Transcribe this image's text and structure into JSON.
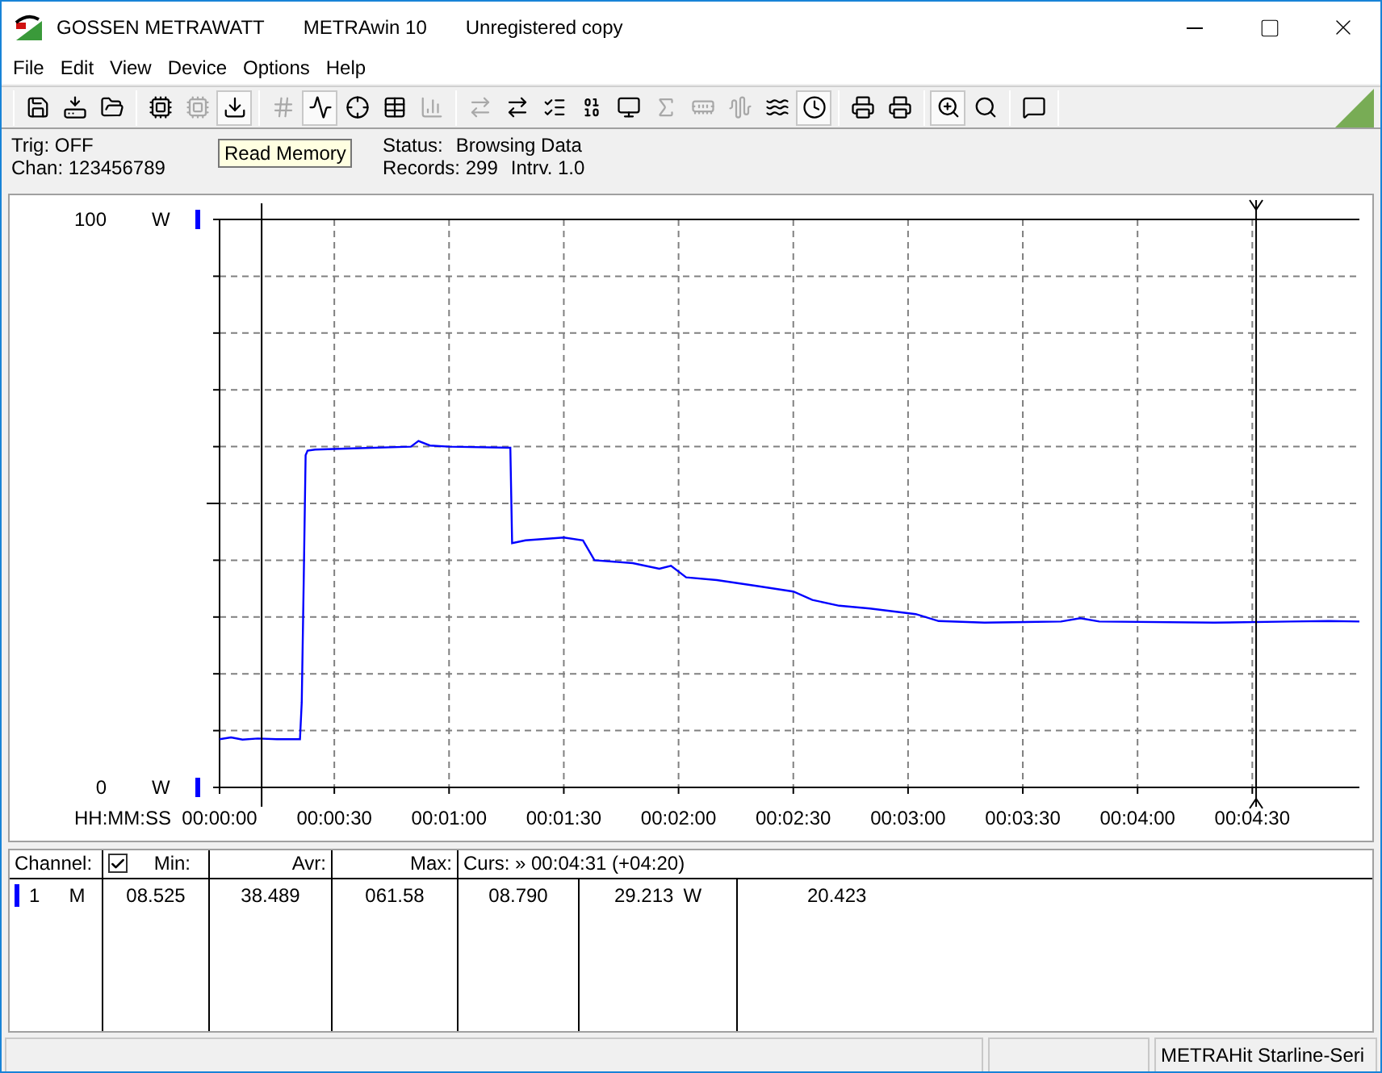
{
  "window": {
    "title_parts": [
      "GOSSEN METRAWATT",
      "METRAwin 10",
      "Unregistered copy"
    ]
  },
  "menu": [
    "File",
    "Edit",
    "View",
    "Device",
    "Options",
    "Help"
  ],
  "toolbar": {
    "groups": [
      [
        {
          "disabled": false,
          "pressed": false
        },
        {
          "disabled": false,
          "pressed": false
        },
        {
          "disabled": false,
          "pressed": false
        }
      ],
      [
        {
          "disabled": false,
          "pressed": false
        },
        {
          "disabled": true,
          "pressed": false
        },
        {
          "disabled": false,
          "pressed": true
        }
      ],
      [
        {
          "disabled": true,
          "pressed": false
        },
        {
          "disabled": false,
          "pressed": true
        },
        {
          "disabled": false,
          "pressed": false
        },
        {
          "disabled": false,
          "pressed": false
        },
        {
          "disabled": true,
          "pressed": false
        }
      ],
      [
        {
          "disabled": true,
          "pressed": false
        },
        {
          "disabled": false,
          "pressed": false
        },
        {
          "disabled": false,
          "pressed": false
        },
        {
          "disabled": false,
          "pressed": false
        },
        {
          "disabled": false,
          "pressed": false
        },
        {
          "disabled": true,
          "pressed": false
        },
        {
          "disabled": true,
          "pressed": false
        },
        {
          "disabled": true,
          "pressed": false
        },
        {
          "disabled": false,
          "pressed": false
        },
        {
          "disabled": false,
          "pressed": true
        }
      ],
      [
        {
          "disabled": false,
          "pressed": false
        },
        {
          "disabled": false,
          "pressed": false
        }
      ],
      [
        {
          "disabled": false,
          "pressed": true
        },
        {
          "disabled": false,
          "pressed": false
        }
      ],
      [
        {
          "disabled": false,
          "pressed": false
        }
      ]
    ]
  },
  "tooltip": "Read Memory",
  "info": {
    "trig": "Trig: OFF",
    "chan": "Chan:  123456789",
    "status_label": "Status:",
    "status_value": "Browsing Data",
    "records": "Records: 299",
    "interval": "Intrv. 1.0"
  },
  "chart": {
    "axis_units": [
      "W",
      "W"
    ],
    "chart_data": {
      "type": "line",
      "xlabel": "HH:MM:SS",
      "x": [
        0,
        3,
        6,
        10,
        15,
        21,
        21.5,
        22,
        22.5,
        23,
        25,
        35,
        50,
        52,
        55,
        60,
        76,
        76.5,
        80,
        90,
        95,
        98,
        108,
        115,
        118,
        122,
        130,
        140,
        150,
        155,
        162,
        170,
        182,
        188,
        200,
        220,
        225,
        230,
        260,
        280,
        290,
        298
      ],
      "series": [
        {
          "color": "#0000ff",
          "values": [
            8.5,
            8.8,
            8.4,
            8.6,
            8.5,
            8.5,
            15,
            36,
            58.5,
            59.3,
            59.5,
            59.7,
            60,
            61,
            60.2,
            60,
            59.8,
            43,
            43.5,
            44,
            43.5,
            40,
            39.5,
            38.5,
            39,
            37,
            36.5,
            35.5,
            34.5,
            33,
            32,
            31.5,
            30.5,
            29.3,
            29,
            29.2,
            29.8,
            29.2,
            29,
            29.2,
            29.3,
            29.2
          ]
        }
      ],
      "xlim": [
        0,
        298
      ],
      "ylim": [
        0,
        100
      ],
      "xticks": [
        {
          "value": 0,
          "label": "00:00:00"
        },
        {
          "value": 30,
          "label": "00:00:30"
        },
        {
          "value": 60,
          "label": "00:01:00"
        },
        {
          "value": 90,
          "label": "00:01:30"
        },
        {
          "value": 120,
          "label": "00:02:00"
        },
        {
          "value": 150,
          "label": "00:02:30"
        },
        {
          "value": 180,
          "label": "00:03:00"
        },
        {
          "value": 210,
          "label": "00:03:30"
        },
        {
          "value": 240,
          "label": "00:04:00"
        },
        {
          "value": 270,
          "label": "00:04:30"
        }
      ],
      "yticks": [
        {
          "value": 100,
          "label": "100"
        },
        {
          "value": 0,
          "label": "0"
        }
      ],
      "grid": true,
      "ref_lines": [
        {
          "axis": "x",
          "value": 11
        },
        {
          "axis": "x",
          "value": 271
        }
      ]
    }
  },
  "channel_table": {
    "header": {
      "channel": "Channel:",
      "checked": true,
      "min": "Min:",
      "avr": "Avr:",
      "max": "Max:",
      "cursor": "Curs: » 00:04:31 (+04:20)"
    },
    "rows": [
      {
        "color": "#0000ff",
        "number": "1",
        "mode": "M",
        "min": "08.525",
        "avr": "38.489",
        "max": "061.58",
        "cursor_1": "08.790",
        "cursor_2": "29.213",
        "unit": "W",
        "cursor_3": "20.423"
      }
    ]
  },
  "status_bar": {
    "device": "METRAHit Starline-Seri"
  }
}
